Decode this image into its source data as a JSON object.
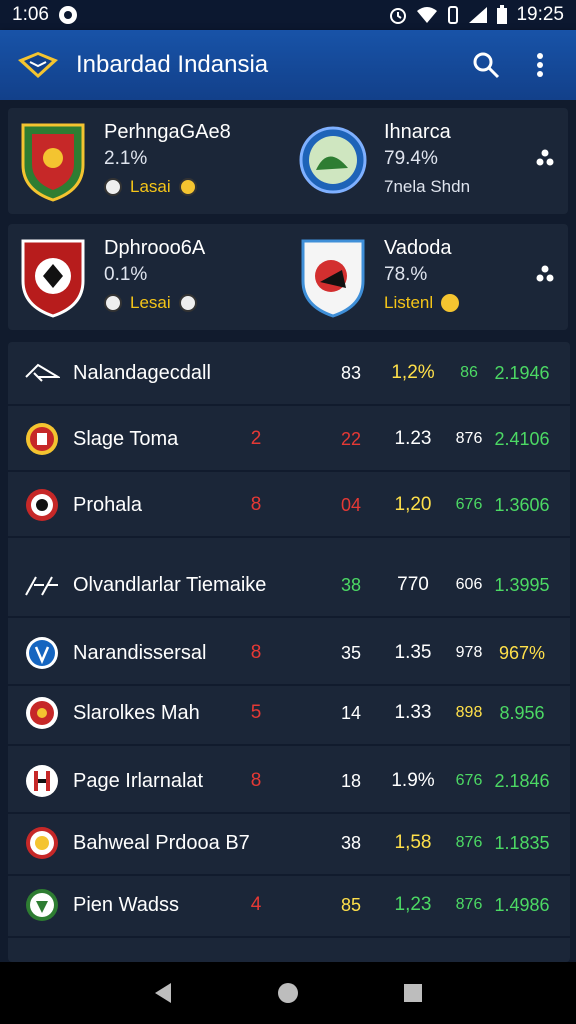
{
  "status_bar": {
    "time": "1:06",
    "clock": "19:25"
  },
  "app_bar": {
    "title": "Inbardad Indansia"
  },
  "matches": [
    {
      "home": {
        "name": "PerhngaGAe8",
        "pct": "2.1%",
        "extra": "Lasai"
      },
      "away": {
        "name": "Ihnarca",
        "pct": "79.4%",
        "extra": "7nela Shdn"
      }
    },
    {
      "home": {
        "name": "Dphrooo6A",
        "pct": "0.1%",
        "extra": "Lesai"
      },
      "away": {
        "name": "Vadoda",
        "pct": "78.%",
        "extra": "Listenl"
      }
    }
  ],
  "rows": [
    {
      "name": "Nalandagecdall",
      "c1": "",
      "c2": "83",
      "c3": "1,2%",
      "c4": "86",
      "c5": "2.1946",
      "c2_color": "#ffffff",
      "c3_color": "#ffe04a",
      "c4_color": "#4cd964",
      "c5_color": "#4cd964"
    },
    {
      "name": "Slage Toma",
      "c1": "2",
      "c2": "22",
      "c3": "1.23",
      "c4": "876",
      "c5": "2.4106",
      "c2_color": "#e53935",
      "c3_color": "#ffffff",
      "c4_color": "#ffffff",
      "c5_color": "#4cd964"
    },
    {
      "name": "Prohala",
      "c1": "8",
      "c2": "04",
      "c3": "1,20",
      "c4": "676",
      "c5": "1.3606",
      "c2_color": "#e53935",
      "c3_color": "#ffe04a",
      "c4_color": "#4cd964",
      "c5_color": "#4cd964"
    },
    {
      "name": "Olvandlarlar Tiemaike",
      "c1": "",
      "c2": "38",
      "c3": "770",
      "c4": "606",
      "c5": "1.3995",
      "c2_color": "#4cd964",
      "c3_color": "#ffffff",
      "c4_color": "#ffffff",
      "c5_color": "#4cd964"
    },
    {
      "name": "Narandissersal",
      "c1": "8",
      "c2": "35",
      "c3": "1.35",
      "c4": "978",
      "c5": "967%",
      "c2_color": "#ffffff",
      "c3_color": "#ffffff",
      "c4_color": "#ffffff",
      "c5_color": "#ffe04a"
    },
    {
      "name": "Slarolkes Mah",
      "c1": "5",
      "c2": "14",
      "c3": "1.33",
      "c4": "898",
      "c5": "8.956",
      "c2_color": "#ffffff",
      "c3_color": "#ffffff",
      "c4_color": "#ffe04a",
      "c5_color": "#4cd964"
    },
    {
      "name": "Page Irlarnalat",
      "c1": "8",
      "c2": "18",
      "c3": "1.9%",
      "c4": "676",
      "c5": "2.1846",
      "c2_color": "#ffffff",
      "c3_color": "#ffffff",
      "c4_color": "#4cd964",
      "c5_color": "#4cd964"
    },
    {
      "name": "Bahweal Prdooa B7",
      "c1": "",
      "c2": "38",
      "c3": "1,58",
      "c4": "876",
      "c5": "1.1835",
      "c2_color": "#ffffff",
      "c3_color": "#ffe04a",
      "c4_color": "#4cd964",
      "c5_color": "#4cd964"
    },
    {
      "name": "Pien Wadss",
      "c1": "4",
      "c2": "85",
      "c3": "1,23",
      "c4": "876",
      "c5": "1.4986",
      "c2_color": "#ffe04a",
      "c3_color": "#4cd964",
      "c4_color": "#4cd964",
      "c5_color": "#4cd964"
    }
  ],
  "colors": {
    "app_bar": "#1853a8",
    "background": "#111b2d",
    "card": "#1b2638",
    "red": "#e53935",
    "yellow": "#ffe04a",
    "green": "#4cd964"
  }
}
